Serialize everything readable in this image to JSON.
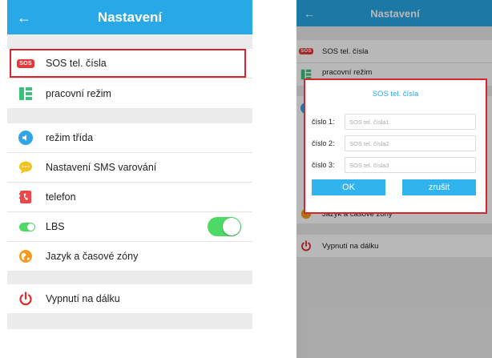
{
  "left_screen": {
    "header": {
      "title": "Nastavení",
      "back_icon": "arrow-left-icon"
    },
    "items": [
      {
        "label": "SOS tel. čísla",
        "icon": "sos-badge-icon",
        "badge_text": "SOS"
      },
      {
        "label": "pracovní režim",
        "icon": "work-mode-icon"
      },
      {
        "label": "režim třída",
        "icon": "speaker-icon"
      },
      {
        "label": "Nastavení SMS varování",
        "icon": "sms-bubble-icon"
      },
      {
        "label": "telefon",
        "icon": "phone-book-icon"
      },
      {
        "label": "LBS",
        "icon": "lbs-toggle-icon",
        "toggle_on": true
      },
      {
        "label": "Jazyk a časové zóny",
        "icon": "globe-icon"
      },
      {
        "label": "Vypnutí  na dálku",
        "icon": "power-icon"
      }
    ]
  },
  "right_screen": {
    "header": {
      "title": "Nastavení",
      "back_icon": "arrow-left-icon"
    },
    "items": [
      {
        "label": "SOS tel. čísla",
        "badge_text": "SOS"
      },
      {
        "label": "pracovní režim"
      },
      {
        "label": "Jazyk a časové zóny"
      },
      {
        "label": "Vypnutí  na dálku"
      }
    ],
    "dialog": {
      "title": "SOS tel. čísla",
      "fields": [
        {
          "label": "číslo 1:",
          "placeholder": "SOS tel. čísla1",
          "value": ""
        },
        {
          "label": "číslo 2:",
          "placeholder": "SOS tel. čísla2",
          "value": ""
        },
        {
          "label": "číslo 3:",
          "placeholder": "SOS tel. čísla3",
          "value": ""
        }
      ],
      "ok_label": "OK",
      "cancel_label": "zrušit"
    }
  },
  "colors": {
    "header_blue": "#28a8e6",
    "button_blue": "#31b3ee",
    "highlight_red": "#d9232d",
    "toggle_green": "#4cd964",
    "background_gray": "#ebebeb"
  }
}
